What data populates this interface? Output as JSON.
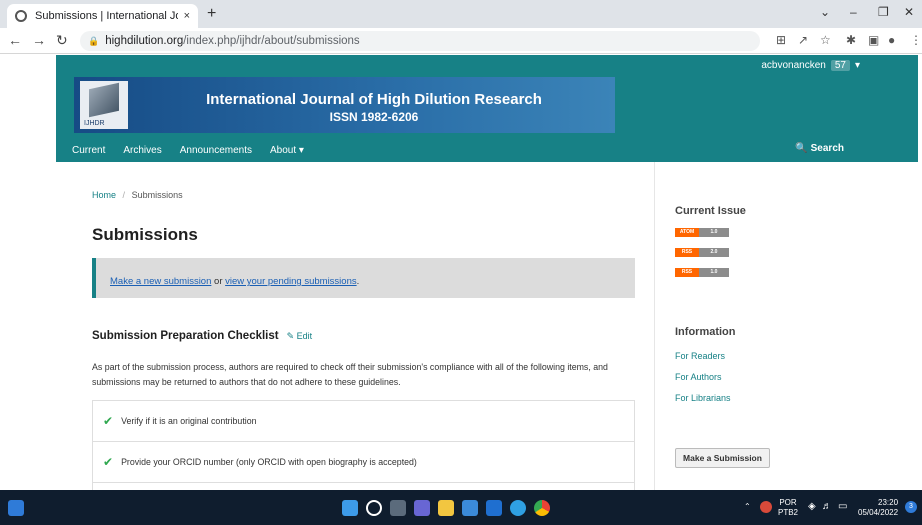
{
  "browser": {
    "tab_title": "Submissions | International Journ",
    "tab_close": "×",
    "new_tab": "+",
    "url_host": "highdilution.org",
    "url_path": "/index.php/ijhdr/about/submissions"
  },
  "site": {
    "user_name": "acbvonancken",
    "user_count": "57",
    "banner_title": "International Journal of High Dilution Research",
    "banner_issn": "ISSN 1982-6206",
    "logo_text": "IJHDR",
    "nav": [
      "Current",
      "Archives",
      "Announcements",
      "About ▾"
    ],
    "search_label": "Search"
  },
  "main": {
    "breadcrumb_home": "Home",
    "breadcrumb_sep": "/",
    "breadcrumb_current": "Submissions",
    "title": "Submissions",
    "notice_link1": "Make a new submission",
    "notice_mid": " or ",
    "notice_link2": "view your pending submissions",
    "notice_end": ".",
    "checklist_title": "Submission Preparation Checklist",
    "edit_label": "Edit",
    "checklist_intro": "As part of the submission process, authors are required to check off their submission's compliance with all of the following items, and submissions may be returned to authors that do not adhere to these guidelines.",
    "checklist_items": [
      "Verify if it is an original contribution",
      "Provide your ORCID number (only ORCID with open biography is accepted)"
    ]
  },
  "sidebar": {
    "current_issue_title": "Current Issue",
    "feeds": [
      {
        "left": "ATOM",
        "right": "1.0"
      },
      {
        "left": "RSS",
        "right": "2.0"
      },
      {
        "left": "RSS",
        "right": "1.0"
      }
    ],
    "information_title": "Information",
    "links": [
      "For Readers",
      "For Authors",
      "For Librarians"
    ],
    "submit_button": "Make a Submission"
  },
  "taskbar": {
    "lang1": "POR",
    "lang2": "PTB2",
    "time": "23:20",
    "date": "05/04/2022"
  },
  "colors": {
    "header_teal": "#178186",
    "taskbar": "#0f1d2e",
    "check_green": "#2fa84f"
  }
}
